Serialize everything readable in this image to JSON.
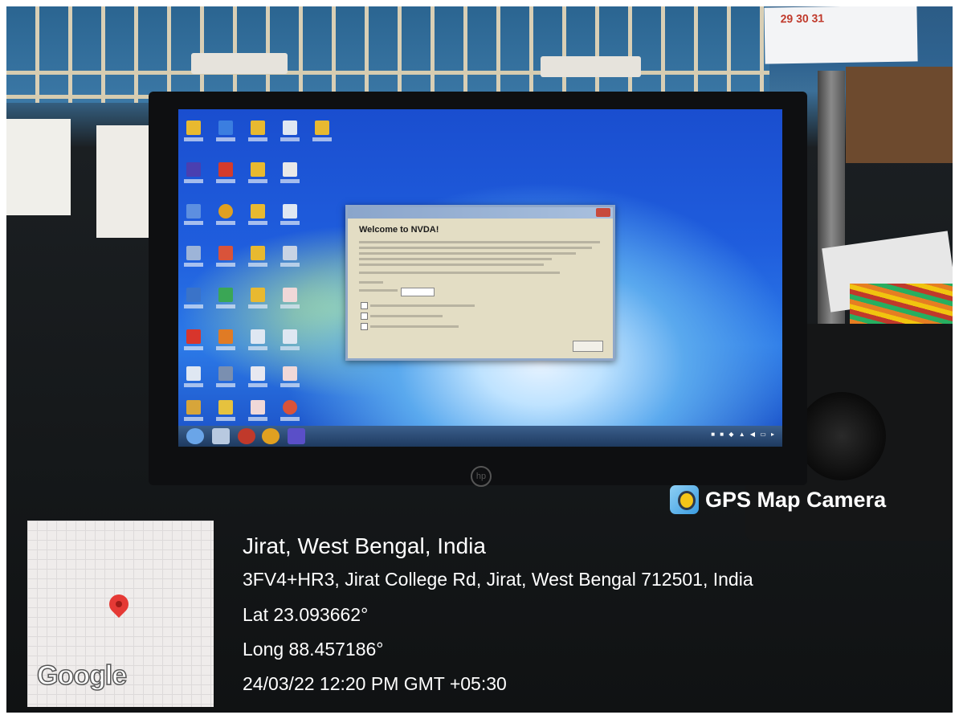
{
  "dialog": {
    "heading": "Welcome to NVDA!"
  },
  "overlay": {
    "app_name": "GPS Map Camera",
    "map_brand": "Google",
    "place": "Jirat, West Bengal, India",
    "address": "3FV4+HR3, Jirat College Rd, Jirat, West Bengal 712501, India",
    "lat": "Lat 23.093662°",
    "long": "Long 88.457186°",
    "timestamp": "24/03/22 12:20 PM GMT +05:30"
  },
  "calendar": {
    "dates": "29 30 31"
  },
  "icons": {
    "gps_camera": "gps-map-camera-icon",
    "map_pin": "map-pin-icon"
  },
  "colors": {
    "screen_blue": "#1f5ddd",
    "pin_red": "#e53935",
    "overlay_text": "#ffffff"
  }
}
